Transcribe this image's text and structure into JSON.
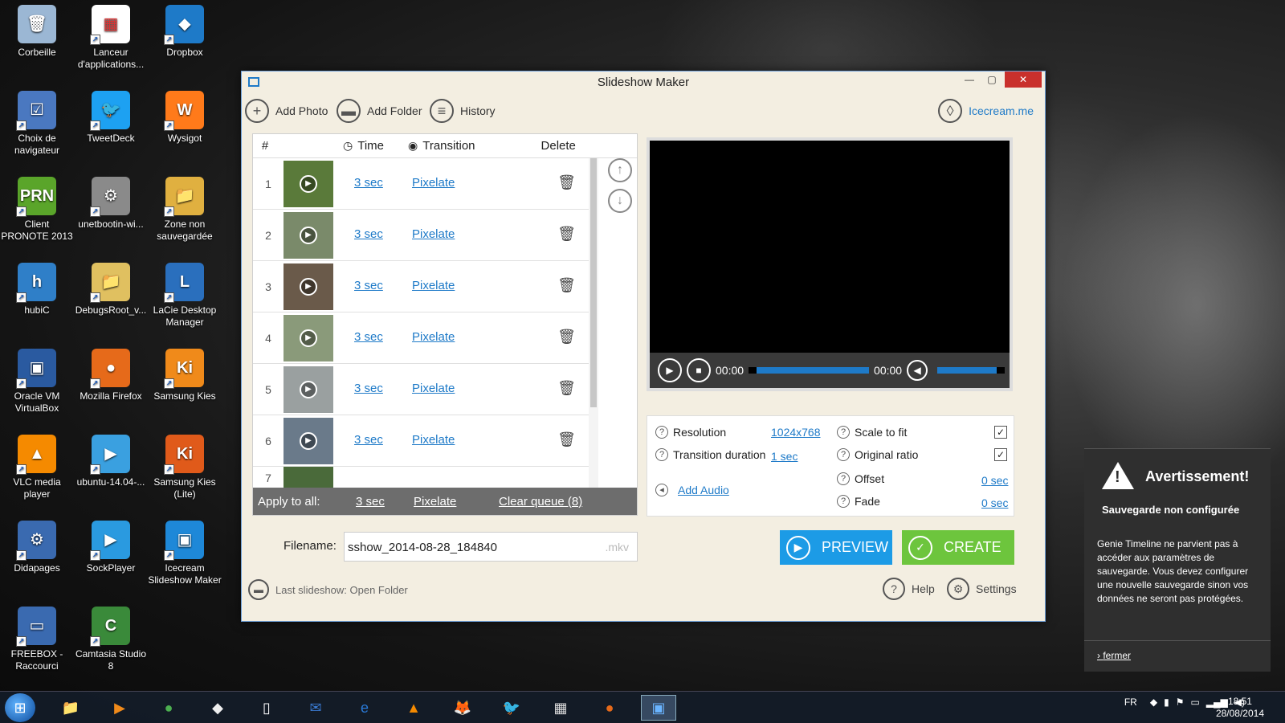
{
  "desktop": {
    "icons": [
      {
        "label": "Corbeille",
        "glyph": "🗑",
        "color": "#9bb7d4"
      },
      {
        "label": "Lanceur d'applications...",
        "glyph": "▦",
        "color": "#ffffff"
      },
      {
        "label": "Dropbox",
        "glyph": "◆",
        "color": "#1e7ac8"
      },
      {
        "label": "Choix de navigateur",
        "glyph": "☑",
        "color": "#4a78c0"
      },
      {
        "label": "TweetDeck",
        "glyph": "🐦",
        "color": "#1da1f2"
      },
      {
        "label": "Wysigot",
        "glyph": "W",
        "color": "#ff7a1a"
      },
      {
        "label": "Client PRONOTE 2013",
        "glyph": "PRN",
        "color": "#5aa52a"
      },
      {
        "label": "unetbootin-wi...",
        "glyph": "⚙",
        "color": "#8a8a8a"
      },
      {
        "label": "Zone non sauvegardée",
        "glyph": "📁",
        "color": "#e0b040"
      },
      {
        "label": "hubiC",
        "glyph": "h",
        "color": "#2f7fc8"
      },
      {
        "label": "DebugsRoot_v...",
        "glyph": "📁",
        "color": "#e0c060"
      },
      {
        "label": "LaCie Desktop Manager",
        "glyph": "L",
        "color": "#2a6fbd"
      },
      {
        "label": "Oracle VM VirtualBox",
        "glyph": "▣",
        "color": "#2a5aa0"
      },
      {
        "label": "Mozilla Firefox",
        "glyph": "●",
        "color": "#e66a1a"
      },
      {
        "label": "Samsung Kies",
        "glyph": "Ki",
        "color": "#f08a1a"
      },
      {
        "label": "VLC media player",
        "glyph": "▲",
        "color": "#f58a00"
      },
      {
        "label": "ubuntu-14.04-...",
        "glyph": "▶",
        "color": "#3aa0e0"
      },
      {
        "label": "Samsung Kies (Lite)",
        "glyph": "Ki",
        "color": "#e05a1a"
      },
      {
        "label": "Didapages",
        "glyph": "⚙",
        "color": "#3a6ab0"
      },
      {
        "label": "SockPlayer",
        "glyph": "▶",
        "color": "#2a9ae0"
      },
      {
        "label": "Icecream Slideshow Maker",
        "glyph": "▣",
        "color": "#1e88d8"
      },
      {
        "label": "FREEBOX - Raccourci",
        "glyph": "▭",
        "color": "#3a6ab0"
      },
      {
        "label": "Camtasia Studio 8",
        "glyph": "C",
        "color": "#3a8a3a"
      }
    ]
  },
  "window": {
    "title": "Slideshow Maker",
    "toolbar": {
      "add_photo": "Add Photo",
      "add_folder": "Add Folder",
      "history": "History",
      "site": "Icecream.me"
    },
    "queue": {
      "headers": {
        "num": "#",
        "time": "Time",
        "transition": "Transition",
        "delete": "Delete"
      },
      "rows": [
        {
          "num": "1",
          "time": "3 sec",
          "transition": "Pixelate",
          "thumb": "#5a7a3a"
        },
        {
          "num": "2",
          "time": "3 sec",
          "transition": "Pixelate",
          "thumb": "#7a8a6a"
        },
        {
          "num": "3",
          "time": "3 sec",
          "transition": "Pixelate",
          "thumb": "#6a5a4a"
        },
        {
          "num": "4",
          "time": "3 sec",
          "transition": "Pixelate",
          "thumb": "#8a9a7a"
        },
        {
          "num": "5",
          "time": "3 sec",
          "transition": "Pixelate",
          "thumb": "#9aa0a0"
        },
        {
          "num": "6",
          "time": "3 sec",
          "transition": "Pixelate",
          "thumb": "#6a7a8a"
        }
      ],
      "apply_label": "Apply to all:",
      "apply_time": "3 sec",
      "apply_transition": "Pixelate",
      "clear": "Clear queue (8)"
    },
    "filename": {
      "label": "Filename:",
      "value": "sshow_2014-08-28_184840",
      "ext": ".mkv"
    },
    "last_slideshow": "Last slideshow: Open Folder",
    "player": {
      "current": "00:00",
      "total": "00:00"
    },
    "settings": {
      "resolution_label": "Resolution",
      "resolution_value": "1024x768",
      "transition_label": "Transition duration",
      "transition_value": "1 sec",
      "add_audio": "Add Audio",
      "scale_label": "Scale to fit",
      "ratio_label": "Original ratio",
      "offset_label": "Offset",
      "offset_value": "0 sec",
      "fade_label": "Fade",
      "fade_value": "0 sec"
    },
    "buttons": {
      "preview": "PREVIEW",
      "create": "CREATE",
      "help": "Help",
      "settings": "Settings"
    }
  },
  "notification": {
    "title": "Avertissement!",
    "subtitle": "Sauvegarde non configurée",
    "body": "Genie Timeline ne parvient pas à accéder aux paramètres de sauvegarde. Vous devez configurer une nouvelle sauvegarde sinon vos données ne seront pas protégées.",
    "close": "fermer"
  },
  "taskbar": {
    "lang": "FR",
    "time": "18:51",
    "date": "28/08/2014",
    "apps": [
      "explorer-icon",
      "media-icon",
      "chrome-icon",
      "inkscape-icon",
      "document-icon",
      "thunderbird-icon",
      "ie-icon",
      "vlc-icon",
      "gimp-icon",
      "tweetdeck-icon",
      "launcher-icon",
      "firefox-icon",
      "slideshow-icon"
    ]
  }
}
